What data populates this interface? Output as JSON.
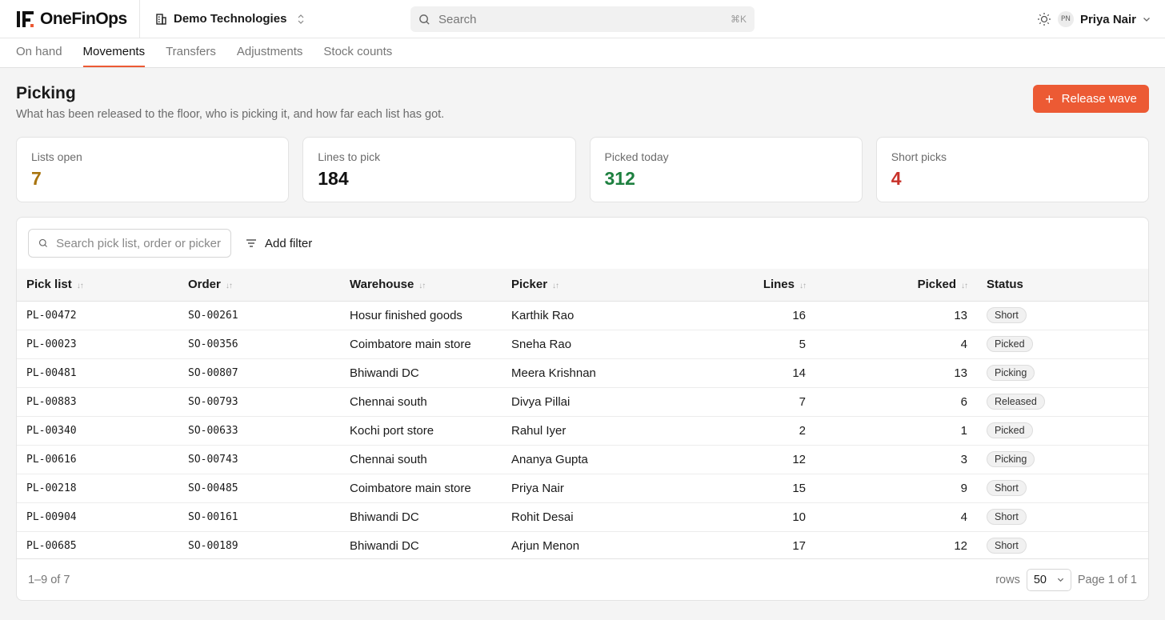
{
  "app": {
    "name": "OneFinOps",
    "logo_text": "1F"
  },
  "org": {
    "name": "Demo Technologies"
  },
  "search": {
    "placeholder": "Search",
    "shortcut": "⌘K"
  },
  "user": {
    "initials": "PN",
    "name": "Priya Nair"
  },
  "tabs": [
    {
      "label": "On hand",
      "active": false
    },
    {
      "label": "Movements",
      "active": true
    },
    {
      "label": "Transfers",
      "active": false
    },
    {
      "label": "Adjustments",
      "active": false
    },
    {
      "label": "Stock counts",
      "active": false
    }
  ],
  "page": {
    "title": "Picking",
    "subtitle": "What has been released to the floor, who is picking it, and how far each list has got.",
    "primary_action": "Release wave"
  },
  "stats": [
    {
      "label": "Lists open",
      "value": "7",
      "color": "#a8740f"
    },
    {
      "label": "Lines to pick",
      "value": "184",
      "color": "#111111"
    },
    {
      "label": "Picked today",
      "value": "312",
      "color": "#1e8040"
    },
    {
      "label": "Short picks",
      "value": "4",
      "color": "#c8322a"
    }
  ],
  "table": {
    "search_placeholder": "Search pick list, order or picker",
    "filter_label": "Add filter",
    "columns": [
      "Pick list",
      "Order",
      "Warehouse",
      "Picker",
      "Lines",
      "Picked",
      "Status"
    ],
    "rows": [
      [
        "PL-00472",
        "SO-00261",
        "Hosur finished goods",
        "Karthik Rao",
        "16",
        "13",
        "Short"
      ],
      [
        "PL-00023",
        "SO-00356",
        "Coimbatore main store",
        "Sneha Rao",
        "5",
        "4",
        "Picked"
      ],
      [
        "PL-00481",
        "SO-00807",
        "Bhiwandi DC",
        "Meera Krishnan",
        "14",
        "13",
        "Picking"
      ],
      [
        "PL-00883",
        "SO-00793",
        "Chennai south",
        "Divya Pillai",
        "7",
        "6",
        "Released"
      ],
      [
        "PL-00340",
        "SO-00633",
        "Kochi port store",
        "Rahul Iyer",
        "2",
        "1",
        "Picked"
      ],
      [
        "PL-00616",
        "SO-00743",
        "Chennai south",
        "Ananya Gupta",
        "12",
        "3",
        "Picking"
      ],
      [
        "PL-00218",
        "SO-00485",
        "Coimbatore main store",
        "Priya Nair",
        "15",
        "9",
        "Short"
      ],
      [
        "PL-00904",
        "SO-00161",
        "Bhiwandi DC",
        "Rohit Desai",
        "10",
        "4",
        "Short"
      ],
      [
        "PL-00685",
        "SO-00189",
        "Bhiwandi DC",
        "Arjun Menon",
        "17",
        "12",
        "Short"
      ]
    ],
    "footer": {
      "range": "1–9 of 7",
      "rows_label": "rows",
      "rows_value": "50",
      "page_info": "Page 1 of 1"
    }
  },
  "colors": {
    "accent": "#ec5a34"
  }
}
